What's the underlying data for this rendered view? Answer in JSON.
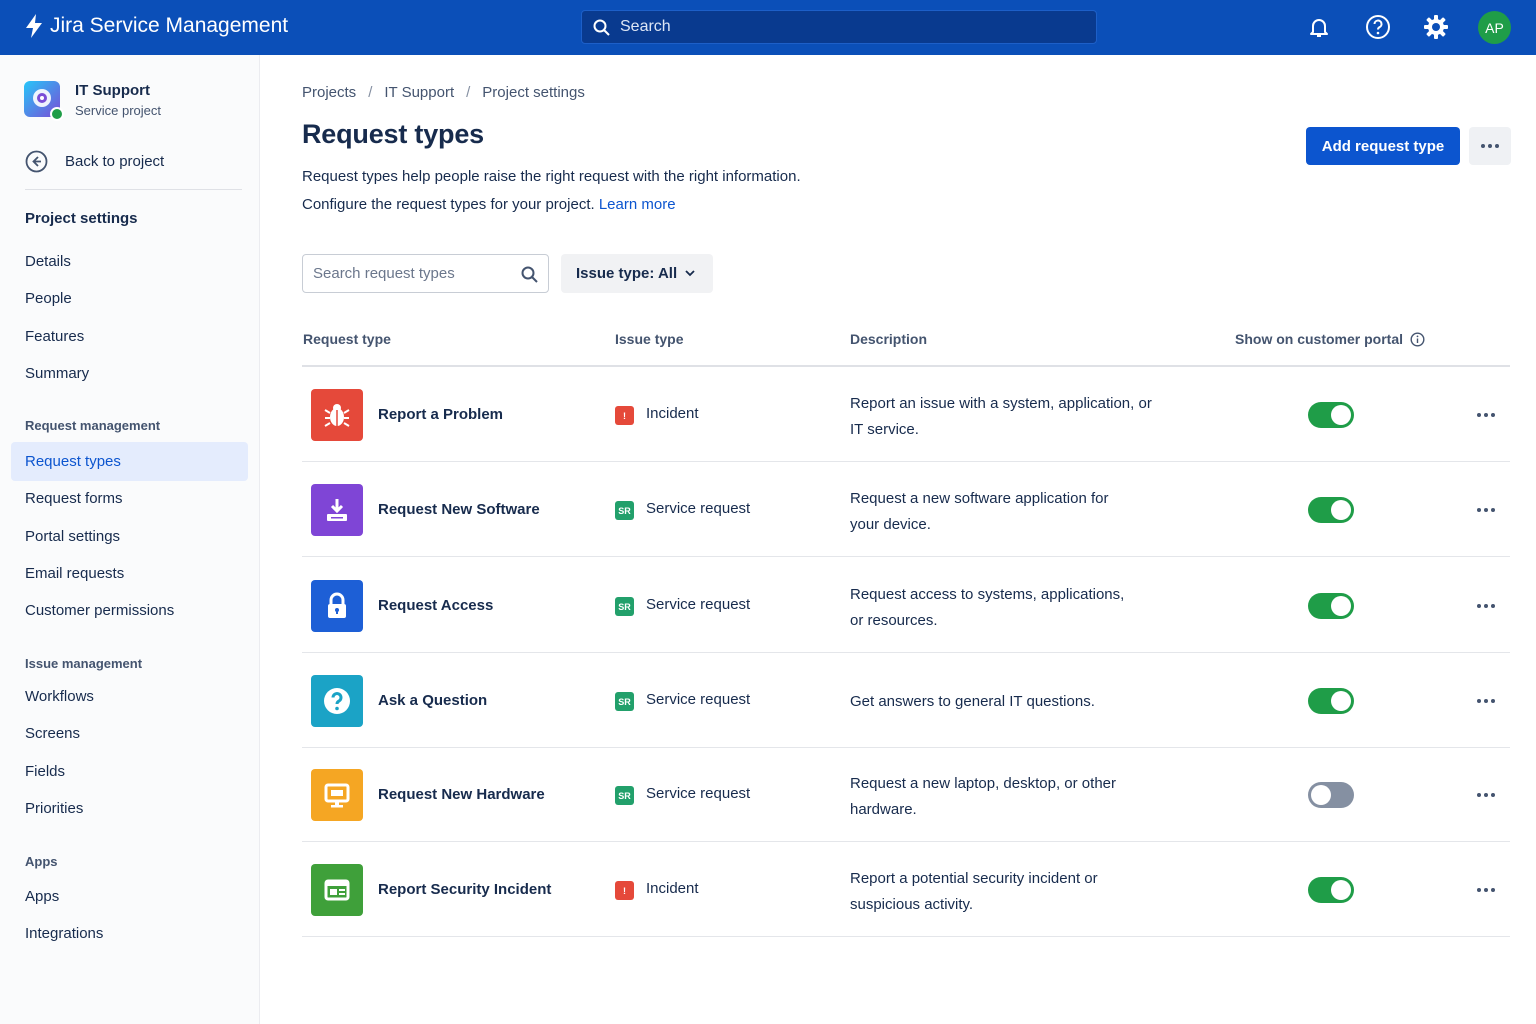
{
  "topnav": {
    "app_name": "Jira Service Management",
    "search_placeholder": "Search",
    "avatar_initials": "AP",
    "brand_color": "#0B4FB8"
  },
  "sidebar": {
    "project_name": "IT Support",
    "project_type": "Service project",
    "back_label": "Back to project",
    "settings_heading": "Project settings",
    "items_top": [
      "Details",
      "People",
      "Features",
      "Summary"
    ],
    "request_group": "Request management",
    "request_items": [
      "Request types",
      "Request forms",
      "Portal settings",
      "Email requests",
      "Customer permissions"
    ],
    "issue_group": "Issue management",
    "issue_items": [
      "Workflows",
      "Screens",
      "Fields",
      "Priorities"
    ],
    "apps_group": "Apps",
    "apps_items": [
      "Apps",
      "Integrations"
    ]
  },
  "breadcrumb": [
    "Projects",
    "IT Support",
    "Project settings"
  ],
  "page": {
    "title": "Request types",
    "description_line1": "Request types help people raise the right request with the right information.",
    "description_line2": "Configure the request types for your project.",
    "learn_more": "Learn more",
    "add_button": "Add request type"
  },
  "filters": {
    "search_placeholder": "Search request types",
    "issue_type_label": "Issue type: All"
  },
  "table": {
    "headers": [
      "Request type",
      "Issue type",
      "Description",
      "Show on customer portal"
    ],
    "rows": [
      {
        "name": "Report a Problem",
        "icon": "bug-icon",
        "color": "#E5493A",
        "issue_badge": "!",
        "issue_type": "Incident",
        "issue_color": "#E5493A",
        "desc1": "Report an issue with a system, application, or",
        "desc2": "IT service.",
        "portal": true
      },
      {
        "name": "Request New Software",
        "icon": "download-icon",
        "color": "#7F45D6",
        "issue_badge": "SR",
        "issue_type": "Service request",
        "issue_color": "#22A06B",
        "desc1": "Request a new software application for",
        "desc2": "your device.",
        "portal": true
      },
      {
        "name": "Request Access",
        "icon": "lock-icon",
        "color": "#1D5FD6",
        "issue_badge": "SR",
        "issue_type": "Service request",
        "issue_color": "#22A06B",
        "desc1": "Request access to systems, applications,",
        "desc2": "or resources.",
        "portal": true
      },
      {
        "name": "Ask a Question",
        "icon": "question-icon",
        "color": "#1BA3C6",
        "issue_badge": "SR",
        "issue_type": "Service request",
        "issue_color": "#22A06B",
        "desc1": "Get answers to general IT questions.",
        "desc2": "",
        "portal": true
      },
      {
        "name": "Request New Hardware",
        "icon": "monitor-icon",
        "color": "#F5A623",
        "issue_badge": "SR",
        "issue_type": "Service request",
        "issue_color": "#22A06B",
        "desc1": "Request a new laptop, desktop, or other",
        "desc2": "hardware.",
        "portal": false
      },
      {
        "name": "Report Security Incident",
        "icon": "id-card-icon",
        "color": "#3FA03A",
        "issue_badge": "!",
        "issue_type": "Incident",
        "issue_color": "#E5493A",
        "desc1": "Report a potential security incident or",
        "desc2": "suspicious activity.",
        "portal": true
      }
    ]
  }
}
